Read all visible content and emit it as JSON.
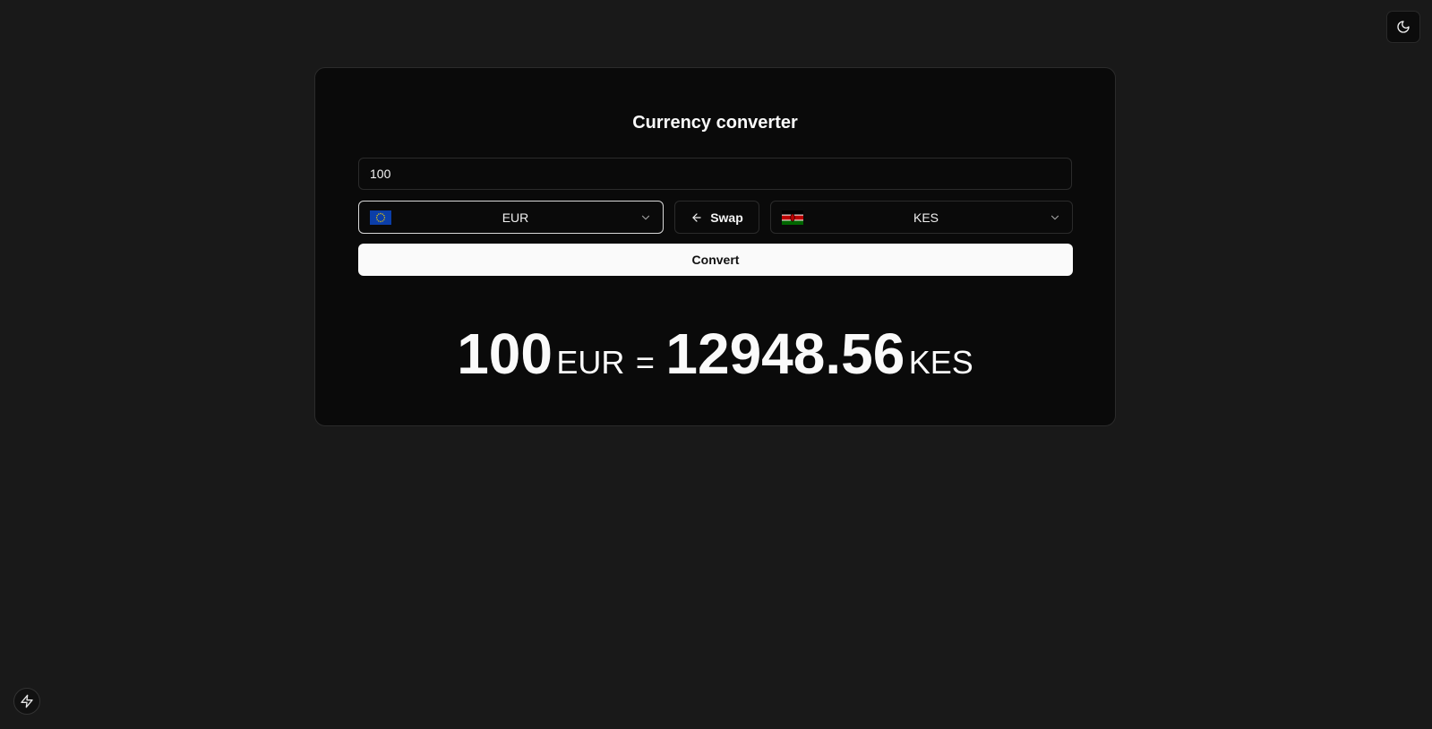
{
  "app": {
    "title": "Currency converter"
  },
  "theme_toggle": {
    "icon": "moon-icon"
  },
  "amount_input": {
    "value": "100"
  },
  "from_select": {
    "code": "EUR",
    "flag": "eu-flag-icon"
  },
  "to_select": {
    "code": "KES",
    "flag": "kenya-flag-icon"
  },
  "swap_button": {
    "label": "Swap",
    "icon": "arrow-left-icon"
  },
  "convert_button": {
    "label": "Convert"
  },
  "result": {
    "amount": "100",
    "from_code": "EUR",
    "equals": "=",
    "converted": "12948.56",
    "to_code": "KES"
  },
  "colors": {
    "page_bg": "#191919",
    "card_bg": "#0a0a0a",
    "border": "#2b2b2b",
    "primary_button_bg": "#fafafa",
    "text": "#fafafa"
  }
}
